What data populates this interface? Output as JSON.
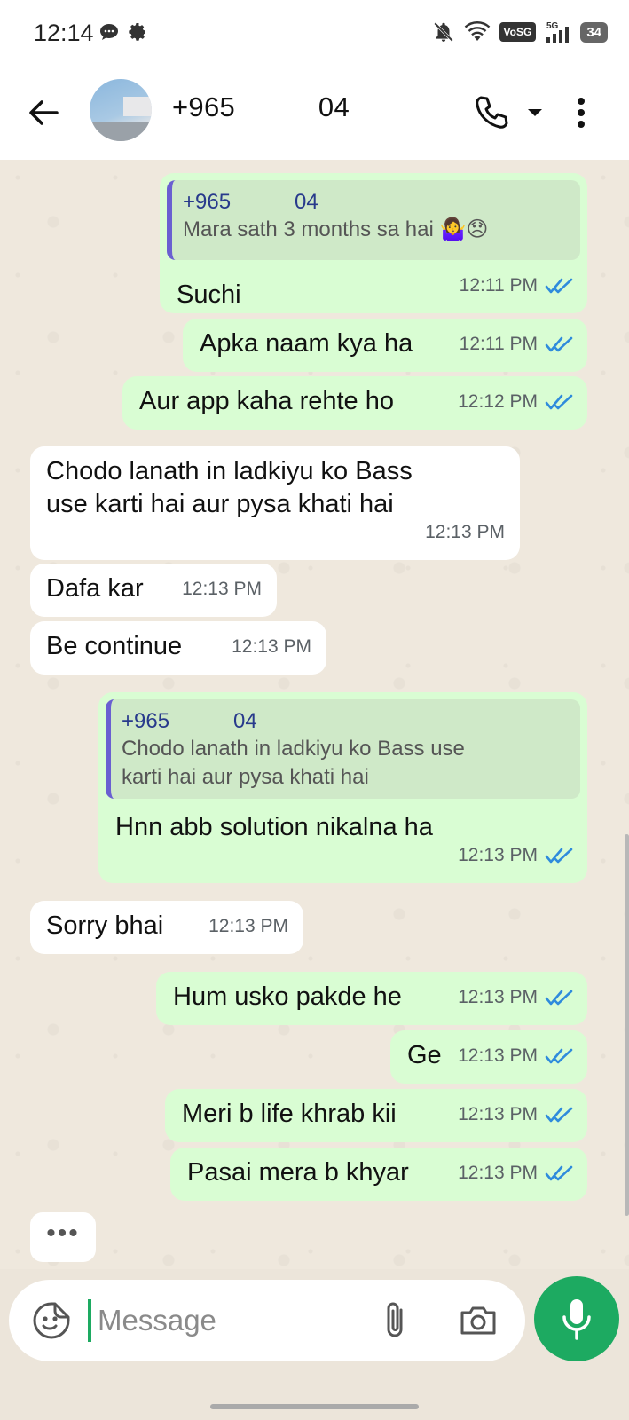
{
  "status_bar": {
    "time": "12:14",
    "network": "VoSG",
    "signal": "5G",
    "battery": "34"
  },
  "header": {
    "contact_name": "+965   04"
  },
  "messages": [
    {
      "dir": "out",
      "quote_name": "+965   04",
      "quote_text": "Mara sath 3 months sa hai 🤷‍♀️😞",
      "text": "Suchi",
      "time": "12:11 PM"
    },
    {
      "dir": "out",
      "text": "Apka naam kya ha",
      "time": "12:11 PM"
    },
    {
      "dir": "out",
      "text": "Aur app kaha rehte ho",
      "time": "12:12 PM"
    },
    {
      "dir": "in",
      "text_line1": "Chodo lanath in ladkiyu ko Bass",
      "text_line2": "use karti hai aur pysa khati hai",
      "time": "12:13 PM"
    },
    {
      "dir": "in",
      "text": "Dafa kar",
      "time": "12:13 PM"
    },
    {
      "dir": "in",
      "text": "Be continue",
      "time": "12:13 PM"
    },
    {
      "dir": "out",
      "quote_name": "+965   04",
      "quote_line1": "Chodo lanath in ladkiyu ko Bass use",
      "quote_line2": "karti hai aur pysa khati hai",
      "text": "Hnn abb solution nikalna ha",
      "time": "12:13 PM"
    },
    {
      "dir": "in",
      "text": "Sorry bhai",
      "time": "12:13 PM"
    },
    {
      "dir": "out",
      "text": "Hum usko pakde he",
      "time": "12:13 PM"
    },
    {
      "dir": "out",
      "text": "Ge",
      "time": "12:13 PM"
    },
    {
      "dir": "out",
      "text": "Meri b life khrab kii",
      "time": "12:13 PM"
    },
    {
      "dir": "out",
      "text": "Pasai mera b khyar",
      "time": "12:13 PM"
    }
  ],
  "typing_indicator": "•••",
  "composer": {
    "placeholder": "Message"
  },
  "colors": {
    "accent": "#1daa61",
    "outgoing_bubble": "#d9fdd3",
    "incoming_bubble": "#ffffff",
    "read_ticks": "#2f8bdc"
  }
}
